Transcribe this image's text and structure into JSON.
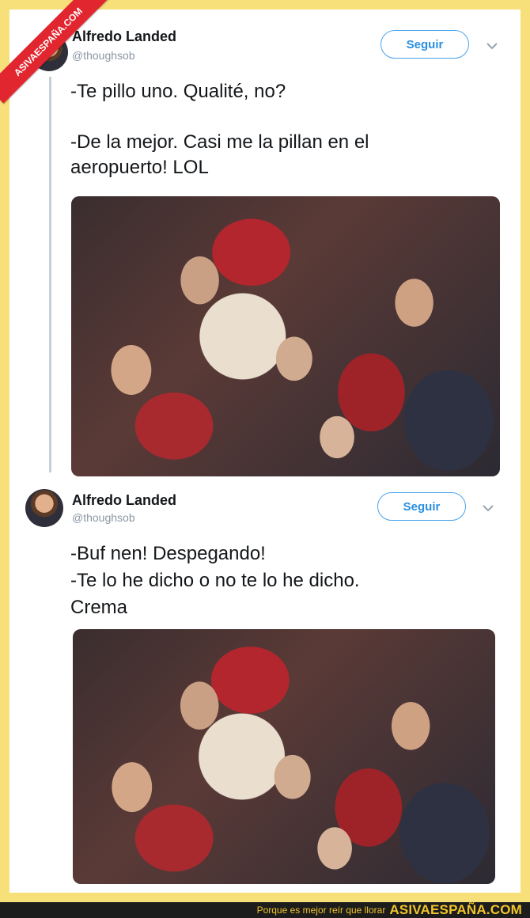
{
  "tweets": [
    {
      "author_name": "Alfredo Landed",
      "handle": "@thoughsob",
      "follow_label": "Seguir",
      "text_lines": [
        "-Te pillo uno. Qualité, no?",
        "",
        "-De la mejor. Casi me la pillan en el",
        "aeropuerto! LOL"
      ]
    },
    {
      "author_name": "Alfredo Landed",
      "handle": "@thoughsob",
      "follow_label": "Seguir",
      "text_lines": [
        "-Buf nen! Despegando!",
        "-Te lo he dicho o no te lo he dicho.",
        "Crema"
      ]
    }
  ],
  "watermark": "ASIVAESPAÑA.COM",
  "footer": {
    "tagline": "Porque es mejor reír que llorar",
    "site": "ASIVAESPAÑA.COM"
  },
  "colors": {
    "frame": "#f7e07a",
    "follow_accent": "#4ba3eb",
    "watermark_red": "#e2262f",
    "footer_text": "#f2c42a"
  }
}
